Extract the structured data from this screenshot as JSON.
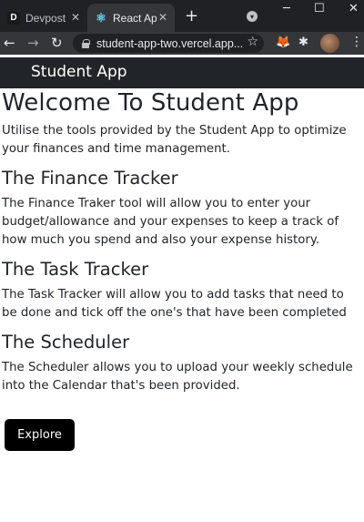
{
  "browser": {
    "tabs": [
      {
        "favicon": "D",
        "title": "Devpost",
        "active": false
      },
      {
        "favicon": "react-icon",
        "title": "React App",
        "active": true
      }
    ],
    "url": "student-app-two.vercel.app...",
    "new_tab_symbol": "+",
    "window_buttons": [
      "─",
      "☐",
      "✕"
    ]
  },
  "navbar": {
    "brand": "Student App"
  },
  "main": {
    "heading": "Welcome To Student App",
    "intro": "Utilise the tools provided by the Student App to optimize your finances and time management.",
    "sections": [
      {
        "title": "The Finance Tracker",
        "text": "The Finance Traker tool will allow you to enter your budget/allowance and your expenses to keep a track of how much you spend and also your expense history."
      },
      {
        "title": "The Task Tracker",
        "text": "The Task Tracker will allow you to add tasks that need to be done and tick off the one's that have been completed"
      },
      {
        "title": "The Scheduler",
        "text": "The Scheduler allows you to upload your weekly schedule into the Calendar that's been provided."
      }
    ],
    "explore_label": "Explore"
  },
  "colors": {
    "navbar_bg": "#212529",
    "button_bg": "#000000",
    "chrome_bg": "#202124",
    "toolbar_bg": "#35363a"
  }
}
